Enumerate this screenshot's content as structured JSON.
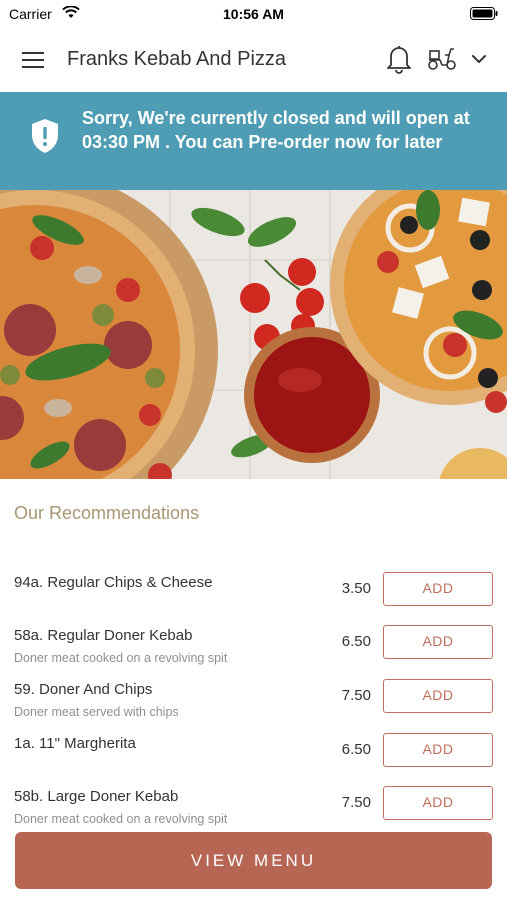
{
  "status_bar": {
    "carrier": "Carrier",
    "time": "10:56 AM"
  },
  "nav": {
    "title": "Franks Kebab And Pizza"
  },
  "banner": {
    "message": "Sorry, We're currently closed and will open at 03:30 PM . You can Pre-order now for later"
  },
  "recommendations": {
    "title": "Our Recommendations",
    "items": [
      {
        "name": "94a. Regular Chips & Cheese",
        "description": "",
        "price": "3.50",
        "button": "ADD"
      },
      {
        "name": "58a. Regular Doner Kebab",
        "description": "Doner meat cooked on a revolving spit",
        "price": "6.50",
        "button": "ADD"
      },
      {
        "name": "59. Doner And Chips",
        "description": "Doner meat served with chips",
        "price": "7.50",
        "button": "ADD"
      },
      {
        "name": "1a. 11\" Margherita",
        "description": "",
        "price": "6.50",
        "button": "ADD"
      },
      {
        "name": "58b. Large Doner Kebab",
        "description": "Doner meat cooked on a revolving spit",
        "price": "7.50",
        "button": "ADD"
      }
    ]
  },
  "view_menu": {
    "label": "VIEW MENU"
  },
  "colors": {
    "banner": "#4e9db4",
    "accent": "#b86654",
    "recommendation_title": "#a89672"
  }
}
